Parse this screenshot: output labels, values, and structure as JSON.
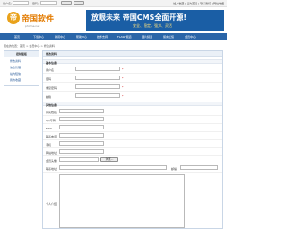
{
  "topbar": {
    "username_label": "用户名：",
    "password_label": "密码：",
    "login_label": "登录",
    "register_label": "注册",
    "links": "加入收藏 | 设为首页 | 联系我们 | 网站地图"
  },
  "header": {
    "logo_mark": "帝",
    "logo_text": "帝国软件",
    "logo_sub": "phome.net",
    "banner_title": "放眼未来 帝国CMS全面开源!",
    "banner_sub": "安全、稳定、强大、灵活"
  },
  "nav": {
    "items": [
      "首页",
      "下载中心",
      "新闻中心",
      "帮助中心",
      "技术支持",
      "FLASH频道",
      "图片频道",
      "留言反馈",
      "会员中心"
    ]
  },
  "breadcrumb": "现在的位置：首页 > 会员中心 > 修改资料",
  "sidebar": {
    "title": "控制面板",
    "items": [
      "修改资料",
      "信息管理",
      "站内短信",
      "我的收藏"
    ]
  },
  "main": {
    "title": "修改资料",
    "section_basic": "基本信息",
    "section_other": "其他信息",
    "basic_fields": [
      {
        "label": "用户名",
        "required": "*"
      },
      {
        "label": "密码",
        "required": "*"
      },
      {
        "label": "重复密码",
        "required": "*"
      },
      {
        "label": "邮箱",
        "required": "*"
      }
    ],
    "other_fields": [
      {
        "label": "真实姓名"
      },
      {
        "label": "QQ号码"
      },
      {
        "label": "MSN"
      },
      {
        "label": "联系电话"
      },
      {
        "label": "手机"
      },
      {
        "label": "网站地址"
      }
    ],
    "photo_label": "会员头像",
    "browse_label": "浏览...",
    "address_label": "联系地址",
    "zip_label": "邮编",
    "intro_label": "个人介绍"
  }
}
